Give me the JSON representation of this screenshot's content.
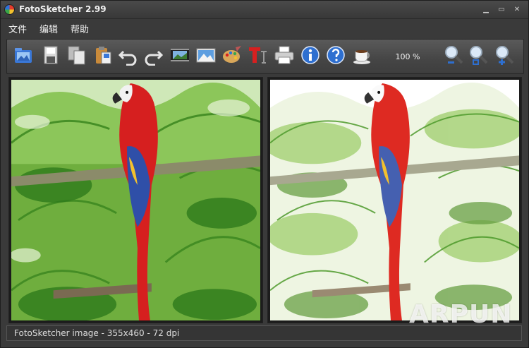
{
  "window": {
    "title": "FotoSketcher 2.99"
  },
  "menu": {
    "items": [
      "文件",
      "编辑",
      "帮助"
    ]
  },
  "toolbar": {
    "zoom_level": "100 %",
    "icons": [
      "open-image-icon",
      "save-icon",
      "copy-icon",
      "paste-icon",
      "undo-icon",
      "redo-icon",
      "batch-process-icon",
      "landscape-image-icon",
      "palette-icon",
      "text-icon",
      "print-icon",
      "info-icon",
      "help-icon",
      "coffee-cup-icon",
      "zoom-out-icon",
      "zoom-fit-icon",
      "zoom-in-icon"
    ]
  },
  "panels": {
    "left": "original-photo",
    "right": "sketched-photo"
  },
  "watermark": {
    "text": "ARPUN"
  },
  "status": {
    "text": "FotoSketcher image - 355x460 - 72 dpi"
  },
  "colors": {
    "background": "#3a3a3a",
    "toolbar": "#4c4c4c",
    "parrot_red": "#d62020",
    "foliage": "#4e9a2c"
  }
}
